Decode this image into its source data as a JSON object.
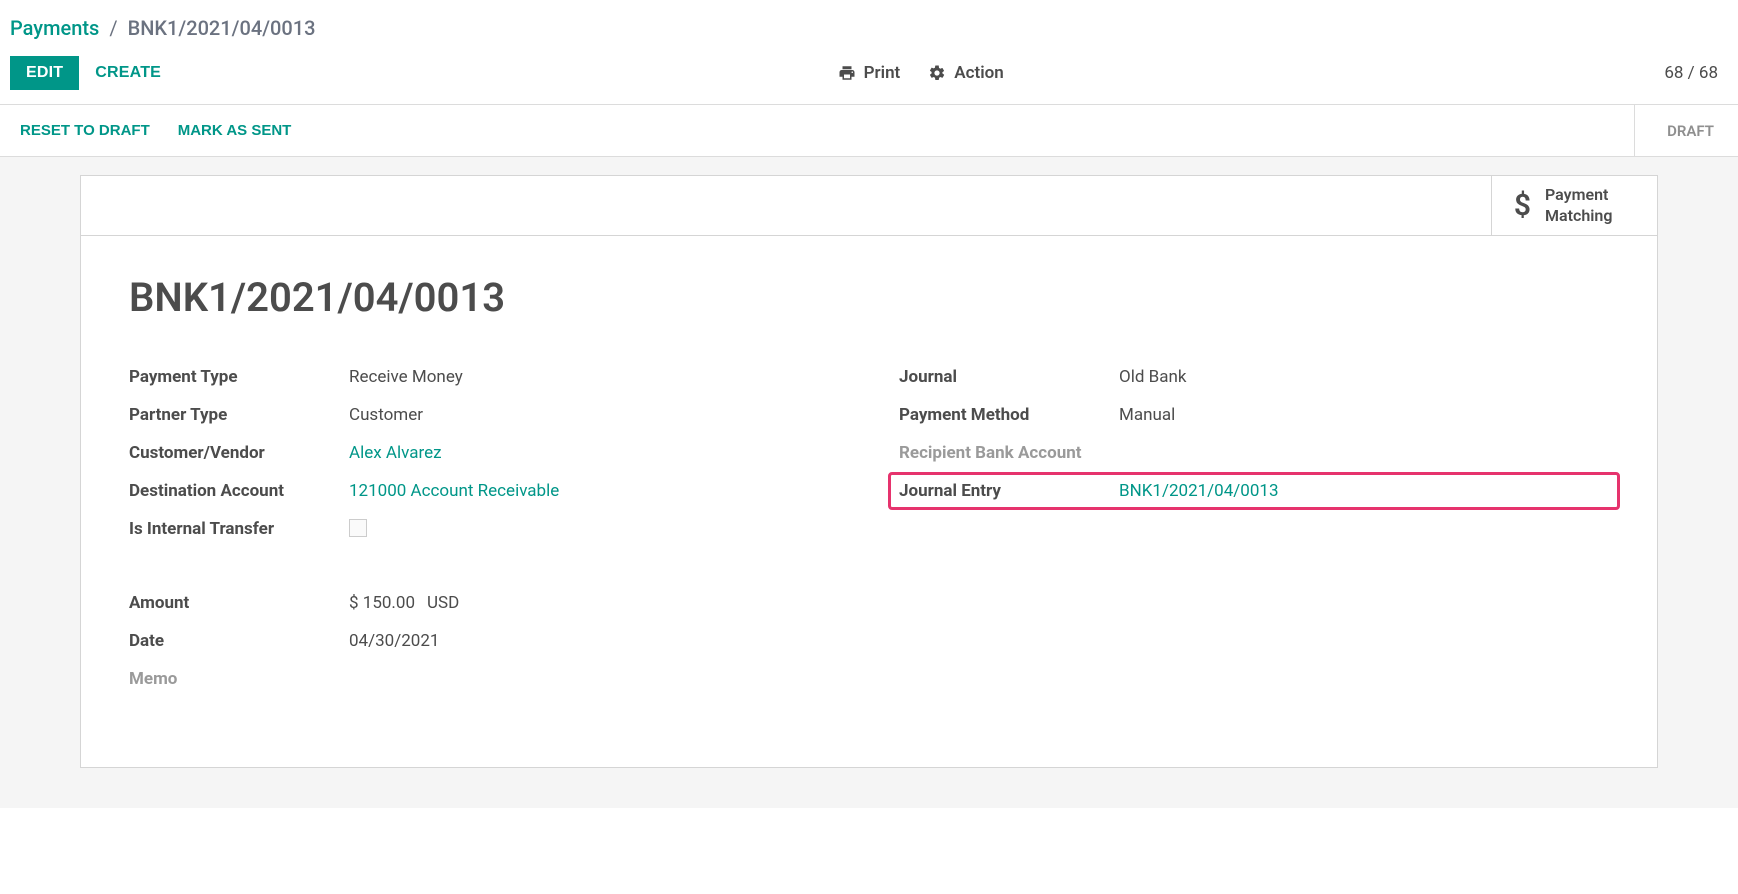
{
  "breadcrumb": {
    "root": "Payments",
    "current": "BNK1/2021/04/0013"
  },
  "toolbar": {
    "edit": "Edit",
    "create": "Create",
    "print": "Print",
    "action": "Action",
    "pager": "68 / 68"
  },
  "statusbar": {
    "reset": "Reset to Draft",
    "mark_sent": "Mark as Sent",
    "status": "Draft"
  },
  "card": {
    "payment_matching": "Payment Matching",
    "title": "BNK1/2021/04/0013"
  },
  "fields_left": {
    "payment_type_label": "Payment Type",
    "payment_type_value": "Receive Money",
    "partner_type_label": "Partner Type",
    "partner_type_value": "Customer",
    "customer_vendor_label": "Customer/Vendor",
    "customer_vendor_value": "Alex Alvarez",
    "destination_account_label": "Destination Account",
    "destination_account_value": "121000 Account Receivable",
    "internal_transfer_label": "Is Internal Transfer",
    "amount_label": "Amount",
    "amount_value": "$ 150.00",
    "amount_currency": "USD",
    "date_label": "Date",
    "date_value": "04/30/2021",
    "memo_label": "Memo"
  },
  "fields_right": {
    "journal_label": "Journal",
    "journal_value": "Old Bank",
    "payment_method_label": "Payment Method",
    "payment_method_value": "Manual",
    "recipient_bank_label": "Recipient Bank Account",
    "journal_entry_label": "Journal Entry",
    "journal_entry_value": "BNK1/2021/04/0013"
  }
}
